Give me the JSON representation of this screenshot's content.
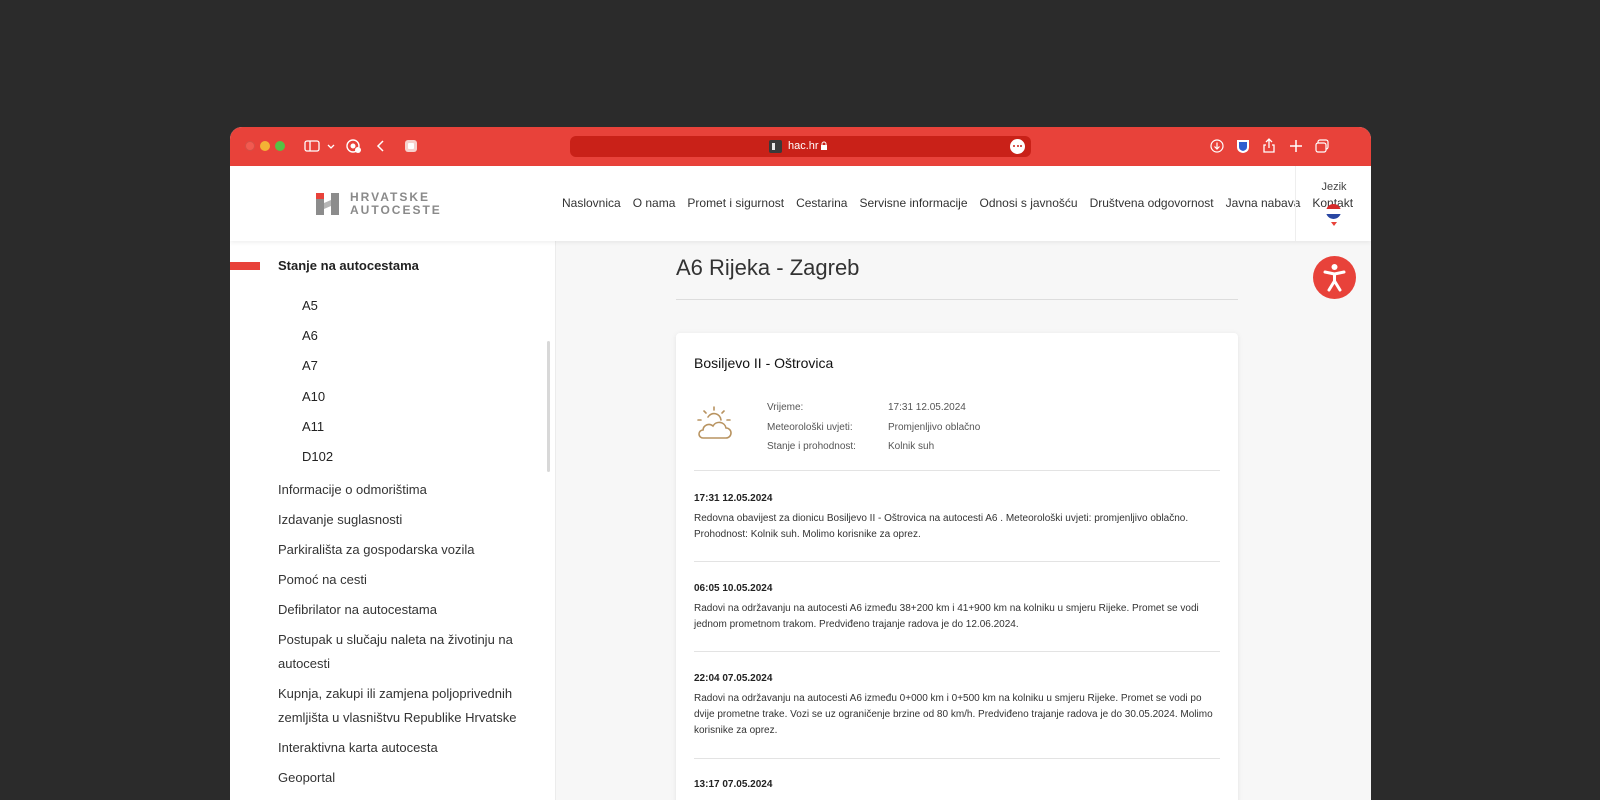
{
  "browser": {
    "url": "hac.hr"
  },
  "header": {
    "logo_line1": "HRVATSKE",
    "logo_line2": "AUTOCESTE",
    "nav": [
      "Naslovnica",
      "O nama",
      "Promet i sigurnost",
      "Cestarina",
      "Servisne informacije",
      "Odnosi s javnošću",
      "Društvena odgovornost",
      "Javna nabava",
      "Kontakt"
    ],
    "lang_label": "Jezik",
    "flag_colors": [
      "#d62b2b",
      "#ffffff",
      "#2a47a3"
    ]
  },
  "sidebar": {
    "section_title": "Stanje na autocestama",
    "sub_items": [
      "A5",
      "A6",
      "A7",
      "A10",
      "A11",
      "D102"
    ],
    "links": [
      "Informacije o odmorištima",
      "Izdavanje suglasnosti",
      "Parkirališta za gospodarska vozila",
      "Pomoć na cesti",
      "Defibrilator na autocestama",
      "Postupak u slučaju naleta na životinju na autocesti",
      "Kupnja, zakupi ili zamjena poljoprivednih zemljišta u vlasništvu Republike Hrvatske",
      "Interaktivna karta autocesta",
      "Geoportal"
    ]
  },
  "main": {
    "page_title": "A6 Rijeka - Zagreb",
    "card": {
      "title": "Bosiljevo II - Oštrovica",
      "weather_icon": "partly-cloudy-icon",
      "details": [
        {
          "label": "Vrijeme:",
          "value": "17:31 12.05.2024"
        },
        {
          "label": "Meteorološki uvjeti:",
          "value": "Promjenljivo oblačno"
        },
        {
          "label": "Stanje i prohodnost:",
          "value": "Kolnik suh"
        }
      ],
      "entries": [
        {
          "time": "17:31 12.05.2024",
          "text": "Redovna obavijest za dionicu Bosiljevo II - Oštrovica na autocesti A6 . Meteorološki uvjeti: promjenljivo oblačno. Prohodnost: Kolnik suh. Molimo korisnike za oprez."
        },
        {
          "time": "06:05 10.05.2024",
          "text": "Radovi na održavanju na autocesti A6 između 38+200 km i 41+900 km na kolniku u smjeru Rijeke. Promet se vodi jednom prometnom trakom. Predviđeno trajanje radova je do 12.06.2024."
        },
        {
          "time": "22:04 07.05.2024",
          "text": "Radovi na održavanju na autocesti A6 između 0+000 km i 0+500 km na kolniku u smjeru Rijeke. Promet se vodi po dvije prometne trake. Vozi se uz ograničenje brzine od 80 km/h. Predviđeno trajanje radova je do 30.05.2024. Molimo korisnike za oprez."
        },
        {
          "time": "13:17 07.05.2024",
          "text": ""
        }
      ]
    }
  },
  "colors": {
    "accent": "#e8423a"
  }
}
